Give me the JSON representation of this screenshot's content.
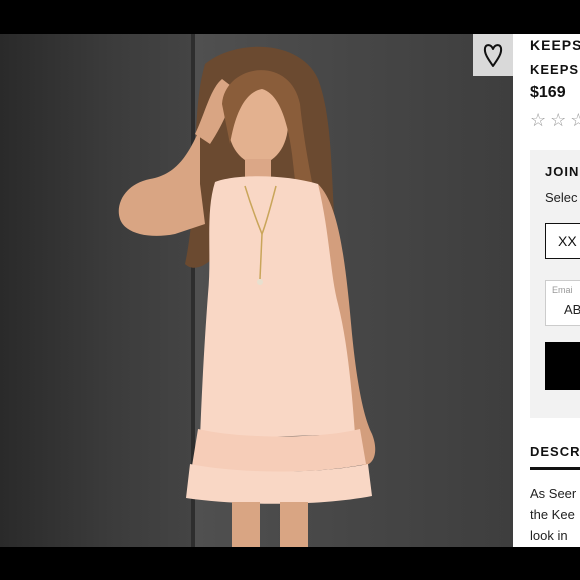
{
  "product": {
    "brand": "KEEPS",
    "name": "KEEPS",
    "price": "$169",
    "stars": "☆☆☆",
    "image_alt": "product-photo"
  },
  "favorite": {
    "icon": "heart-icon"
  },
  "join": {
    "title": "JOIN",
    "select_text": "Selec",
    "size_value": "XX",
    "email_label": "Emai",
    "email_value": "AB"
  },
  "description": {
    "title": "DESCR",
    "lines": [
      "As Seer",
      "the Kee",
      "look in"
    ]
  },
  "colors": {
    "dress": "#f9d7c5",
    "wall_dark": "#2a2a2a",
    "wall_light": "#4e4e4e",
    "panel_bg": "#ffffff",
    "join_bg": "#f2f2f2"
  }
}
